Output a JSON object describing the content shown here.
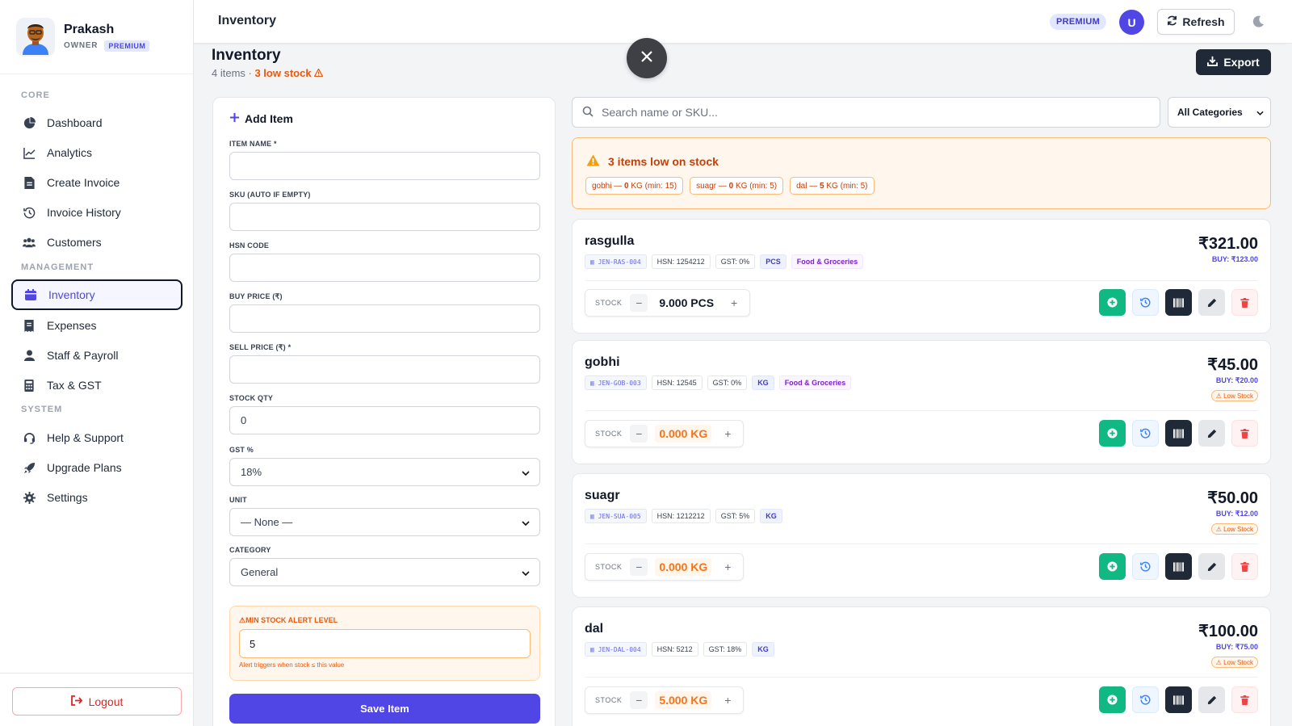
{
  "profile": {
    "name": "Prakash",
    "role": "OWNER",
    "plan": "PREMIUM"
  },
  "nav": {
    "core_label": "CORE",
    "management_label": "MANAGEMENT",
    "system_label": "SYSTEM",
    "items": [
      {
        "label": "Dashboard",
        "icon": "pie-chart-icon"
      },
      {
        "label": "Analytics",
        "icon": "line-chart-icon"
      },
      {
        "label": "Create Invoice",
        "icon": "invoice-icon"
      },
      {
        "label": "Invoice History",
        "icon": "history-icon"
      },
      {
        "label": "Customers",
        "icon": "users-icon"
      },
      {
        "label": "Inventory",
        "icon": "box-icon",
        "active": true
      },
      {
        "label": "Expenses",
        "icon": "receipt-icon"
      },
      {
        "label": "Staff & Payroll",
        "icon": "user-icon"
      },
      {
        "label": "Tax & GST",
        "icon": "calculator-icon"
      },
      {
        "label": "Help & Support",
        "icon": "headset-icon"
      },
      {
        "label": "Upgrade Plans",
        "icon": "rocket-icon"
      },
      {
        "label": "Settings",
        "icon": "gear-icon"
      }
    ],
    "logout_label": "Logout"
  },
  "topbar": {
    "title": "Inventory",
    "plan_badge": "PREMIUM",
    "avatar_letter": "U",
    "refresh_label": "Refresh"
  },
  "page": {
    "title": "Inventory",
    "item_count": "4 items",
    "separator": " · ",
    "low_stock_text": "3 low stock",
    "export_label": "Export"
  },
  "form": {
    "heading": "Add Item",
    "item_name_label": "ITEM NAME *",
    "item_name_value": "",
    "sku_label": "SKU (AUTO IF EMPTY)",
    "sku_value": "",
    "hsn_label": "HSN CODE",
    "hsn_value": "",
    "buy_label": "BUY PRICE (₹)",
    "buy_value": "",
    "sell_label": "SELL PRICE (₹) *",
    "sell_value": "",
    "stock_label": "STOCK QTY",
    "stock_value": "0",
    "gst_label": "GST %",
    "gst_value": "18%",
    "unit_label": "UNIT",
    "unit_value": "— None —",
    "category_label": "CATEGORY",
    "category_value": "General",
    "min_alert_label": "MIN STOCK ALERT LEVEL",
    "min_alert_value": "5",
    "min_alert_help": "Alert triggers when stock ≤ this value",
    "save_label": "Save Item"
  },
  "search": {
    "placeholder": "Search name or SKU...",
    "category_filter": "All Categories"
  },
  "low_stock": {
    "title": "3 items low on stock",
    "chips": [
      {
        "name": "gobhi",
        "qty": "0",
        "unit": "KG",
        "min": "(min: 15)"
      },
      {
        "name": "suagr",
        "qty": "0",
        "unit": "KG",
        "min": "(min: 5)"
      },
      {
        "name": "dal",
        "qty": "5",
        "unit": "KG",
        "min": "(min: 5)"
      }
    ]
  },
  "items": [
    {
      "name": "rasgulla",
      "sku": "JEN-RAS-004",
      "hsn": "HSN: 1254212",
      "gst": "GST: 0%",
      "unit": "PCS",
      "category": "Food & Groceries",
      "price": "₹321.00",
      "buy": "BUY: ₹123.00",
      "low_badge": "",
      "stock_label": "STOCK",
      "stock": "9.000 PCS",
      "is_low": false
    },
    {
      "name": "gobhi",
      "sku": "JEN-GOB-003",
      "hsn": "HSN: 12545",
      "gst": "GST: 0%",
      "unit": "KG",
      "category": "Food & Groceries",
      "price": "₹45.00",
      "buy": "BUY: ₹20.00",
      "low_badge": "Low Stock",
      "stock_label": "STOCK",
      "stock": "0.000 KG",
      "is_low": true
    },
    {
      "name": "suagr",
      "sku": "JEN-SUA-005",
      "hsn": "HSN: 1212212",
      "gst": "GST: 5%",
      "unit": "KG",
      "category": "",
      "price": "₹50.00",
      "buy": "BUY: ₹12.00",
      "low_badge": "Low Stock",
      "stock_label": "STOCK",
      "stock": "0.000 KG",
      "is_low": true
    },
    {
      "name": "dal",
      "sku": "JEN-DAL-004",
      "hsn": "HSN: 5212",
      "gst": "GST: 18%",
      "unit": "KG",
      "category": "",
      "price": "₹100.00",
      "buy": "BUY: ₹75.00",
      "low_badge": "Low Stock",
      "stock_label": "STOCK",
      "stock": "5.000 KG",
      "is_low": true
    }
  ],
  "colors": {
    "accent": "#4f46e5",
    "warning": "#ea580c",
    "success": "#10b981",
    "danger": "#dc2626",
    "dark": "#1f2937"
  }
}
